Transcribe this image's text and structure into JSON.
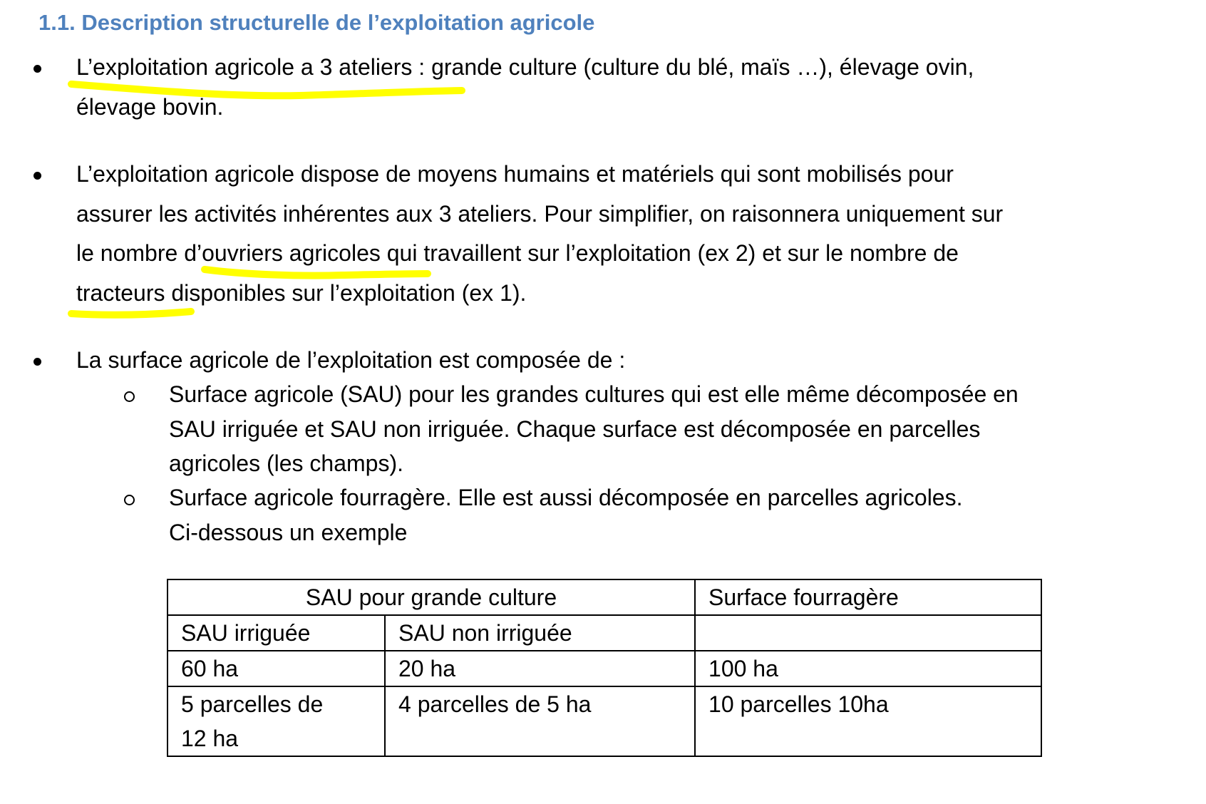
{
  "heading": "1.1.  Description  structurelle de l’exploitation agricole",
  "bullets": {
    "b1": {
      "l1": "L’exploitation agricole a 3 ateliers : grande culture (culture du blé, maïs …), élevage ovin,",
      "l2": "élevage bovin."
    },
    "b2": {
      "l1": "L’exploitation agricole dispose de moyens humains et matériels qui sont mobilisés pour",
      "l2": "assurer les activités inhérentes aux 3 ateliers. Pour simplifier, on raisonnera uniquement sur",
      "l3": "le nombre d’ouvriers agricoles qui travaillent sur l’exploitation (ex 2)  et sur le nombre de",
      "l4": "tracteurs disponibles sur l’exploitation (ex 1)."
    },
    "b3": {
      "l1": "La surface agricole de l’exploitation est composée de :"
    }
  },
  "subitems": {
    "s1": {
      "l1": "Surface agricole (SAU) pour les grandes cultures qui est elle même décomposée en",
      "l2": "SAU irriguée et SAU non irriguée. Chaque surface est décomposée en parcelles",
      "l3": "agricoles (les champs)."
    },
    "s2": {
      "l1": "Surface agricole fourragère. Elle est aussi décomposée en parcelles agricoles.",
      "l2": "Ci-dessous un exemple"
    }
  },
  "table": {
    "header_group": "SAU pour grande culture",
    "header_fourrage": "Surface fourragère",
    "sub_irriguee": "SAU irriguée",
    "sub_non_irriguee": "SAU non irriguée",
    "sub_fourrage": "",
    "row1": {
      "irriguee": "60 ha",
      "non_irriguee": "20 ha",
      "fourrage": "100 ha"
    },
    "row2": {
      "irriguee_l1": "5 parcelles de",
      "irriguee_l2": "12 ha",
      "non_irriguee": "4 parcelles de 5 ha",
      "fourrage": "10 parcelles 10ha"
    }
  },
  "highlight_color": "#FFFF00",
  "heading_color": "#4F81BD"
}
